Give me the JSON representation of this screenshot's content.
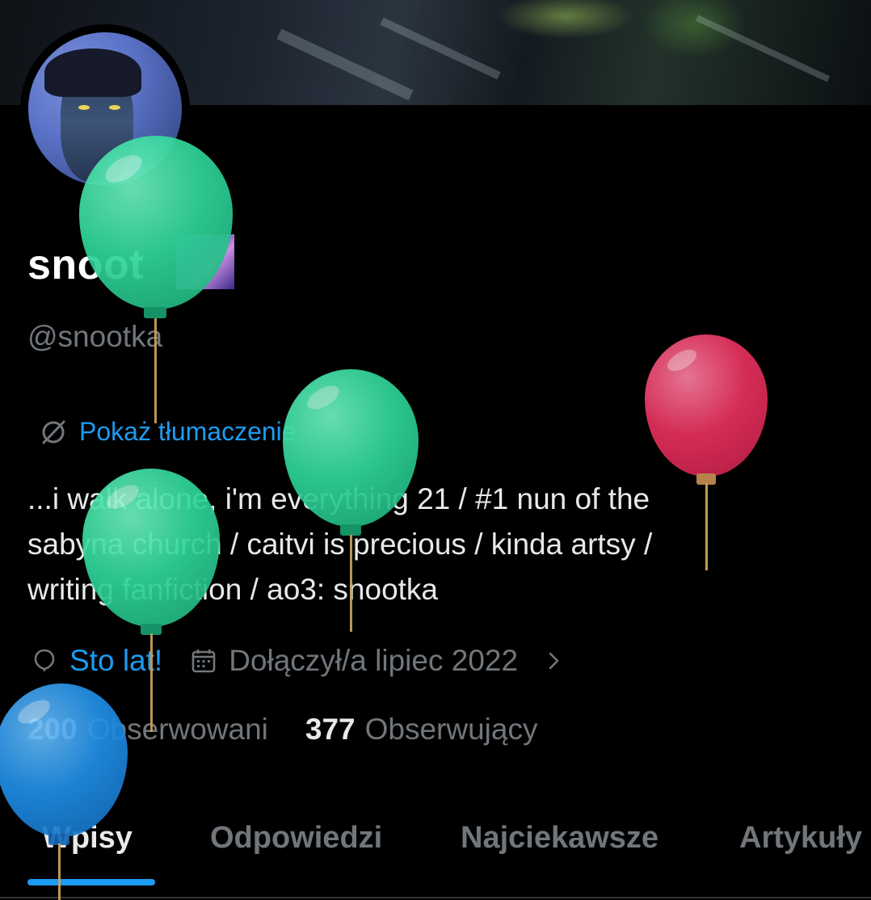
{
  "profile": {
    "display_name": "snoot",
    "handle": "@snootka",
    "translate_label": "Pokaż tłumaczenie",
    "bio_lines": [
      "...i walk alone, i'm everything  21 / #1 nun of the",
      "sabyna church / caitvi is precious / kinda artsy /",
      "writing fanfiction / ao3: snootka"
    ],
    "birthday_label": "Sto lat!",
    "joined_label": "Dołączył/a lipiec 2022",
    "following_count": "200",
    "following_label": "Obserwowani",
    "followers_count": "377",
    "followers_label": "Obserwujący"
  },
  "tabs": [
    {
      "label": "Wpisy",
      "active": true
    },
    {
      "label": "Odpowiedzi",
      "active": false
    },
    {
      "label": "Najciekawsze",
      "active": false
    },
    {
      "label": "Artykuły",
      "active": false
    }
  ],
  "icons": {
    "translate": "translate-icon",
    "birthday": "balloon-icon",
    "calendar": "calendar-icon",
    "chevron": "chevron-right-icon"
  },
  "colors": {
    "accent": "#1d9bf0",
    "background": "#000000",
    "muted_text": "#71767b",
    "balloon_green": "#2fd699",
    "balloon_red": "#e0305a",
    "balloon_blue": "#1f8fe8"
  }
}
